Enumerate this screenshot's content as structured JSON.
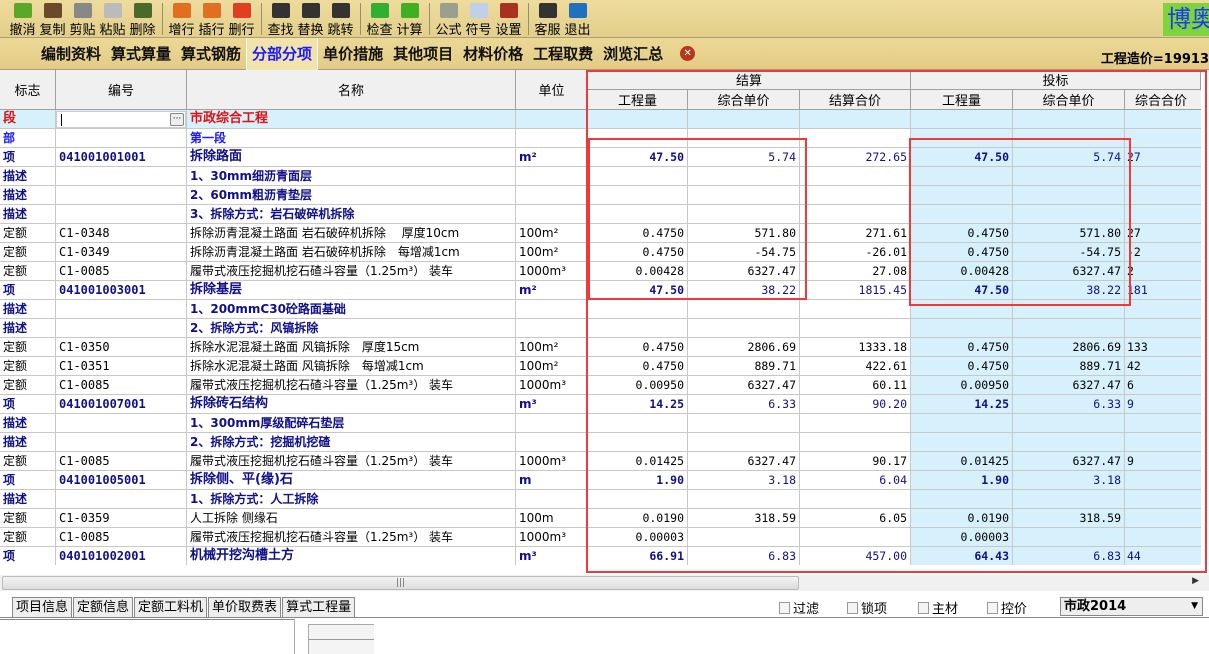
{
  "toolbar": {
    "buttons": [
      {
        "label": "撤消",
        "icon": "undo-icon",
        "color": "#5aa828"
      },
      {
        "label": "复制",
        "icon": "copy-icon",
        "color": "#6a4a2a"
      },
      {
        "label": "剪贴",
        "icon": "scissors-icon",
        "color": "#888888"
      },
      {
        "label": "粘贴",
        "icon": "paste-icon",
        "color": "#bbbbbb"
      },
      {
        "label": "删除",
        "icon": "trash-icon",
        "color": "#4a6a2a"
      },
      {
        "label": "增行",
        "icon": "add-row-icon",
        "color": "#e07020"
      },
      {
        "label": "插行",
        "icon": "insert-row-icon",
        "color": "#e07020"
      },
      {
        "label": "删行",
        "icon": "delete-row-icon",
        "color": "#e04020"
      },
      {
        "label": "查找",
        "icon": "binoculars-find-icon",
        "color": "#333333"
      },
      {
        "label": "替换",
        "icon": "binoculars-replace-icon",
        "color": "#333333"
      },
      {
        "label": "跳转",
        "icon": "binoculars-jump-icon",
        "color": "#333333"
      },
      {
        "label": "检查",
        "icon": "check-icon",
        "color": "#30b030"
      },
      {
        "label": "计算",
        "icon": "arrow-right-icon",
        "color": "#40b020"
      },
      {
        "label": "公式",
        "icon": "calculator-icon",
        "color": "#9aa090"
      },
      {
        "label": "符号",
        "icon": "symbol-icon",
        "color": "#c0d0e8"
      },
      {
        "label": "设置",
        "icon": "tools-icon",
        "color": "#aa3020"
      },
      {
        "label": "客服",
        "icon": "headset-icon",
        "color": "#333333"
      },
      {
        "label": "退出",
        "icon": "exit-icon",
        "color": "#2070c0"
      }
    ],
    "logo": "博奥"
  },
  "tabs": [
    "编制资料",
    "算式算量",
    "算式钢筋",
    "分部分项",
    "单价措施",
    "其他项目",
    "材料价格",
    "工程取费",
    "浏览汇总"
  ],
  "active_tab": "分部分项",
  "project_cost": "工程造价=19913",
  "grid": {
    "headers": {
      "flag": "标志",
      "code": "编号",
      "name": "名称",
      "unit": "单位",
      "settle": "结算",
      "bid": "投标",
      "qty": "工程量",
      "unit_price": "综合单价",
      "settle_total": "结算合价",
      "bid_qty": "工程量",
      "bid_unit_price": "综合单价",
      "bid_total": "综合合价"
    },
    "rows": [
      [
        "段",
        "",
        "市政综合工程",
        "",
        "",
        "",
        "",
        "",
        "",
        ""
      ],
      [
        "部",
        "",
        "第一段",
        "",
        "",
        "",
        "",
        "",
        "",
        ""
      ],
      [
        "项",
        "041001001001",
        "拆除路面",
        "m²",
        "47.50",
        "5.74",
        "272.65",
        "47.50",
        "5.74",
        "27"
      ],
      [
        "描述",
        "",
        "1、30mm细沥青面层",
        "",
        "",
        "",
        "",
        "",
        "",
        ""
      ],
      [
        "描述",
        "",
        "2、60mm粗沥青垫层",
        "",
        "",
        "",
        "",
        "",
        "",
        ""
      ],
      [
        "描述",
        "",
        "3、拆除方式：岩石破碎机拆除",
        "",
        "",
        "",
        "",
        "",
        "",
        ""
      ],
      [
        "定额",
        "C1-0348",
        "拆除沥青混凝土路面 岩石破碎机拆除　 厚度10cm",
        "100m²",
        "0.4750",
        "571.80",
        "271.61",
        "0.4750",
        "571.80",
        "27"
      ],
      [
        "定额",
        "C1-0349",
        "拆除沥青混凝土路面 岩石破碎机拆除　每增减1cm",
        "100m²",
        "0.4750",
        "-54.75",
        "-26.01",
        "0.4750",
        "-54.75",
        "-2"
      ],
      [
        "定额",
        "C1-0085",
        "履带式液压挖掘机挖石碴斗容量（1.25m³） 装车",
        "1000m³",
        "0.00428",
        "6327.47",
        "27.08",
        "0.00428",
        "6327.47",
        "2"
      ],
      [
        "项",
        "041001003001",
        "拆除基层",
        "m²",
        "47.50",
        "38.22",
        "1815.45",
        "47.50",
        "38.22",
        "181"
      ],
      [
        "描述",
        "",
        "1、200mmC30砼路面基础",
        "",
        "",
        "",
        "",
        "",
        "",
        ""
      ],
      [
        "描述",
        "",
        "2、拆除方式：风镐拆除",
        "",
        "",
        "",
        "",
        "",
        "",
        ""
      ],
      [
        "定额",
        "C1-0350",
        "拆除水泥混凝土路面 风镐拆除　厚度15cm",
        "100m²",
        "0.4750",
        "2806.69",
        "1333.18",
        "0.4750",
        "2806.69",
        "133"
      ],
      [
        "定额",
        "C1-0351",
        "拆除水泥混凝土路面 风镐拆除　每增减1cm",
        "100m²",
        "0.4750",
        "889.71",
        "422.61",
        "0.4750",
        "889.71",
        "42"
      ],
      [
        "定额",
        "C1-0085",
        "履带式液压挖掘机挖石碴斗容量（1.25m³） 装车",
        "1000m³",
        "0.00950",
        "6327.47",
        "60.11",
        "0.00950",
        "6327.47",
        "6"
      ],
      [
        "项",
        "041001007001",
        "拆除砖石结构",
        "m³",
        "14.25",
        "6.33",
        "90.20",
        "14.25",
        "6.33",
        "9"
      ],
      [
        "描述",
        "",
        "1、300mm厚级配碎石垫层",
        "",
        "",
        "",
        "",
        "",
        "",
        ""
      ],
      [
        "描述",
        "",
        "2、拆除方式：挖掘机挖碴",
        "",
        "",
        "",
        "",
        "",
        "",
        ""
      ],
      [
        "定额",
        "C1-0085",
        "履带式液压挖掘机挖石碴斗容量（1.25m³） 装车",
        "1000m³",
        "0.01425",
        "6327.47",
        "90.17",
        "0.01425",
        "6327.47",
        "9"
      ],
      [
        "项",
        "041001005001",
        "拆除侧、平(缘)石",
        "m",
        "1.90",
        "3.18",
        "6.04",
        "1.90",
        "3.18",
        ""
      ],
      [
        "描述",
        "",
        "1、拆除方式：人工拆除",
        "",
        "",
        "",
        "",
        "",
        "",
        ""
      ],
      [
        "定额",
        "C1-0359",
        "人工拆除 侧缘石",
        "100m",
        "0.0190",
        "318.59",
        "6.05",
        "0.0190",
        "318.59",
        ""
      ],
      [
        "定额",
        "C1-0085",
        "履带式液压挖掘机挖石碴斗容量（1.25m³） 装车",
        "1000m³",
        "0.00003",
        "",
        "",
        "0.00003",
        "",
        ""
      ],
      [
        "项",
        "040101002001",
        "机械开挖沟槽土方",
        "m³",
        "66.91",
        "6.83",
        "457.00",
        "64.43",
        "6.83",
        "44"
      ]
    ]
  },
  "bottom_tabs": [
    "项目信息",
    "定额信息",
    "定额工料机",
    "单价取费表",
    "算式工程量"
  ],
  "checkboxes": [
    {
      "label": "过滤",
      "checked": false
    },
    {
      "label": "锁项",
      "checked": false
    },
    {
      "label": "主材",
      "checked": false
    },
    {
      "label": "控价",
      "checked": false
    }
  ],
  "standard_select": "市政2014",
  "colors": {
    "highlight_box": "#f03a3a",
    "bid_column_bg": "#d6f0fc",
    "active_tab": "#1a1aff",
    "segment_text": "#e01010",
    "item_text": "#10108a"
  }
}
